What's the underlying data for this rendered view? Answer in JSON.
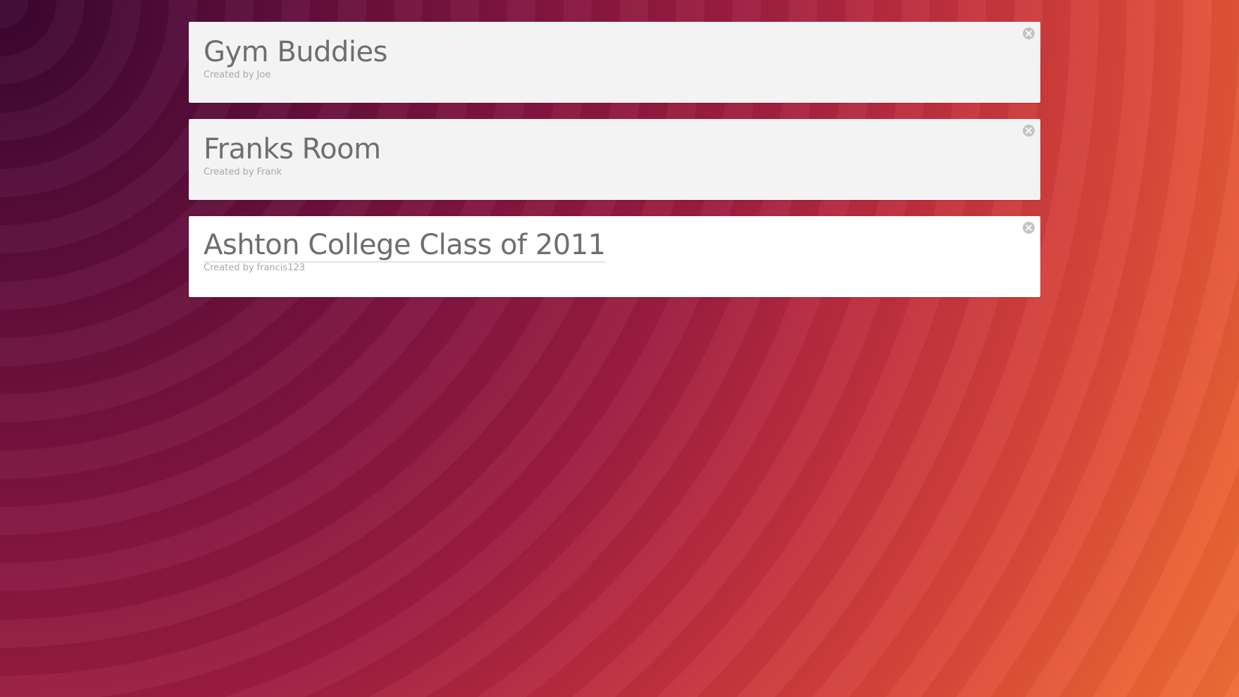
{
  "groups": [
    {
      "name": "Gym Buddies",
      "created_by_prefix": "Created by",
      "creator": "Joe",
      "selected": false
    },
    {
      "name": "Franks Room",
      "created_by_prefix": "Created by",
      "creator": "Frank",
      "selected": false
    },
    {
      "name": "Ashton College Class of 2011",
      "created_by_prefix": "Created by",
      "creator": "francis123",
      "selected": true
    }
  ],
  "icons": {
    "close": "close-icon"
  },
  "colors": {
    "card_background": "#f3f3f3",
    "selected_card_background": "#ffffff",
    "title_text": "#6e6e6e",
    "subtitle_text": "#a8a8a8",
    "close_icon": "#c4c4c4"
  }
}
